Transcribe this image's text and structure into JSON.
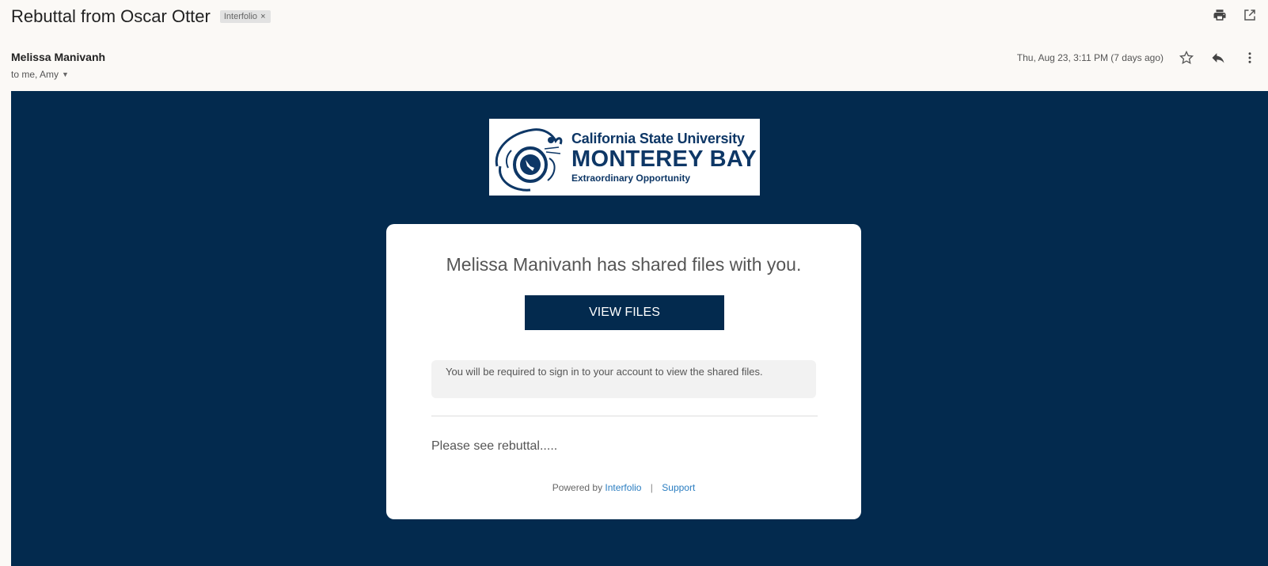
{
  "email": {
    "subject": "Rebuttal from Oscar Otter",
    "label": "Interfolio",
    "label_close": "×",
    "sender": "Melissa Manivanh",
    "recipients": "to me, Amy",
    "date": "Thu, Aug 23, 3:11 PM (7 days ago)"
  },
  "icons": {
    "print": "print-icon",
    "open_new": "open-in-new-window-icon",
    "star": "star-icon",
    "reply": "reply-icon",
    "more": "more-vert-icon",
    "recipients_caret": "caret-down-icon"
  },
  "logo": {
    "line1": "California State University",
    "line2": "MONTEREY BAY",
    "line3": "Extraordinary Opportunity"
  },
  "card": {
    "title": "Melissa Manivanh has shared files with you.",
    "button": "VIEW FILES",
    "notice": "You will be required to sign in to your account to view the shared files.",
    "message": "Please see rebuttal.....",
    "footer_prefix": "Powered by",
    "footer_link1": "Interfolio",
    "footer_sep": "|",
    "footer_link2": "Support"
  },
  "colors": {
    "banner": "#032a4e",
    "button": "#032a4e",
    "link": "#2a7dc1"
  }
}
